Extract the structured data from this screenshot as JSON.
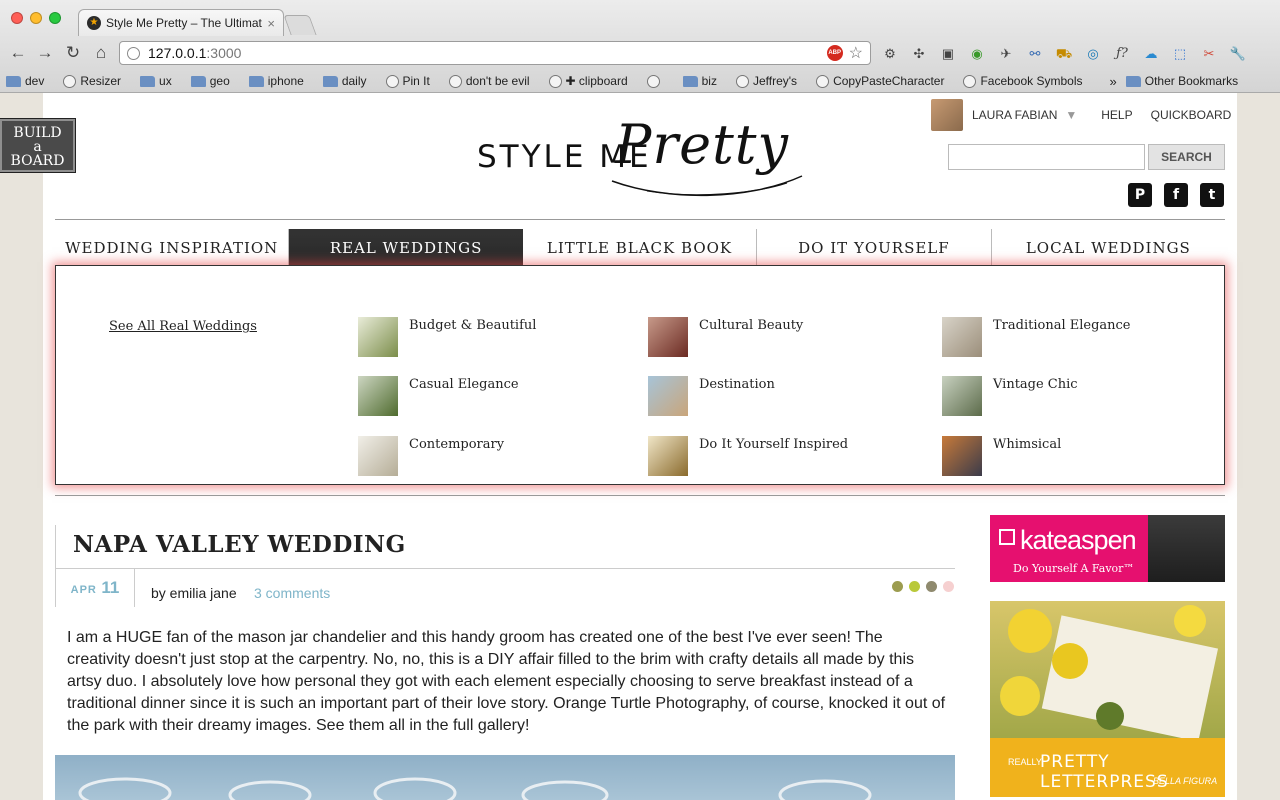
{
  "browser": {
    "tab_title": "Style Me Pretty – The Ultimat",
    "tab_close": "×",
    "url_host": "127.0.0.1",
    "url_port": ":3000",
    "abp_label": "ABP",
    "bookmarks": [
      {
        "label": "dev",
        "icon": "folder-icon"
      },
      {
        "label": "Resizer",
        "icon": "globe-icon"
      },
      {
        "label": "ux",
        "icon": "folder-icon"
      },
      {
        "label": "geo",
        "icon": "folder-icon"
      },
      {
        "label": "iphone",
        "icon": "folder-icon"
      },
      {
        "label": "daily",
        "icon": "folder-icon"
      },
      {
        "label": "Pin It",
        "icon": "globe-icon"
      },
      {
        "label": "don't be evil",
        "icon": "globe-icon"
      },
      {
        "label": "✚ clipboard",
        "icon": "globe-icon"
      },
      {
        "label": "",
        "icon": "globe-icon"
      },
      {
        "label": "biz",
        "icon": "folder-icon"
      },
      {
        "label": "Jeffrey's",
        "icon": "globe-icon"
      },
      {
        "label": "CopyPasteCharacter",
        "icon": "globe-icon"
      },
      {
        "label": "Facebook Symbols",
        "icon": "globe-icon"
      }
    ],
    "bookmarks_more": "»",
    "other_bookmarks": "Other Bookmarks"
  },
  "site": {
    "build_board": [
      "BUILD",
      "a",
      "BOARD"
    ],
    "user_name": "LAURA FABIAN",
    "help": "HELP",
    "quickboard": "QUICKBOARD",
    "search_label": "SEARCH",
    "search_value": "",
    "logo_small": "STYLE ME",
    "logo_script": "Pretty",
    "social": [
      {
        "icon": "pinterest-icon",
        "glyph": "P"
      },
      {
        "icon": "facebook-icon",
        "glyph": "f"
      },
      {
        "icon": "twitter-icon",
        "glyph": "t"
      }
    ],
    "nav": [
      "WEDDING INSPIRATION",
      "REAL WEDDINGS",
      "LITTLE BLACK BOOK",
      "DO IT YOURSELF",
      "LOCAL WEDDINGS"
    ],
    "nav_active_index": 1,
    "mega_see_all": "See All Real Weddings",
    "categories": [
      "Budget & Beautiful",
      "Cultural Beauty",
      "Traditional Elegance",
      "Casual Elegance",
      "Destination",
      "Vintage Chic",
      "Contemporary",
      "Do It Yourself Inspired",
      "Whimsical"
    ],
    "colors": {
      "accent_blue": "#7fb5c9",
      "menu_glow": "#e64646",
      "active_nav": "#2f2f2f"
    }
  },
  "post": {
    "title": "NAPA VALLEY WEDDING",
    "month": "APR",
    "day": "11",
    "author": "by emilia jane",
    "comments": "3 comments",
    "color_dots": [
      "#9c9c4f",
      "#b9c93a",
      "#8f8a6e",
      "#f6d0d0"
    ],
    "body": "I am a HUGE fan of the mason jar chandelier and this handy groom has created one of the best I've ever seen! The creativity doesn't just stop at the carpentry. No, no, this is a DIY affair filled to the brim with crafty details all made by this artsy duo. I absolutely love how personal they got with each element especially choosing to serve breakfast instead of a traditional dinner since it is such an important part of their love story. Orange Turtle Photography, of course, knocked it out of the park with their dreamy images. See them all in the full gallery!"
  },
  "ads": {
    "kate_brand": "kateaspen",
    "kate_tag": "Do Yourself A Favor™",
    "letterpress_really": "REALLY",
    "letterpress_title": "PRETTY LETTERPRESS",
    "letterpress_sub": "BELLA FIGURA"
  }
}
